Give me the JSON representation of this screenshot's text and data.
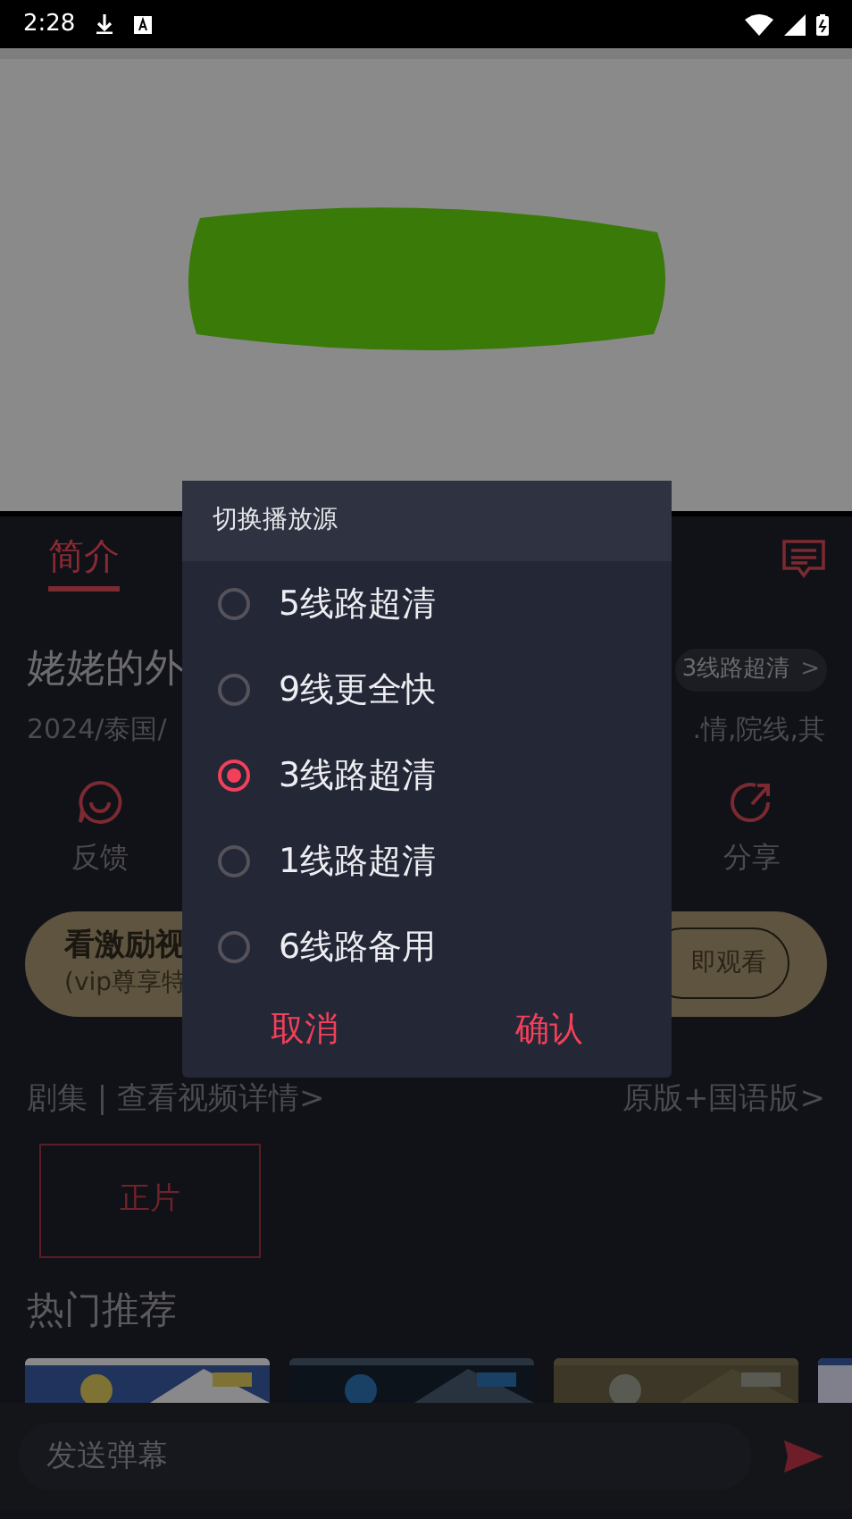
{
  "status_bar": {
    "time": "2:28"
  },
  "tabs": [
    {
      "label": "简介",
      "selected": true
    }
  ],
  "title": {
    "text": "姥姥的外",
    "source_badge": "3线路超清",
    "badge_arrow": ">"
  },
  "meta": {
    "left": "2024/泰国/",
    "right": ".情,院线,其"
  },
  "actions": [
    {
      "kind": "feedback",
      "label": "反馈"
    },
    {
      "kind": "share",
      "label": "分享"
    }
  ],
  "promo": {
    "title": "看激励视",
    "subtitle": "(vip尊享特",
    "button": "即观看"
  },
  "episodes": {
    "label": "剧集 | 查看视频详情>",
    "version": "原版+国语版>",
    "items": [
      {
        "label": "正片",
        "selected": true
      }
    ]
  },
  "recommend": {
    "title": "热门推荐"
  },
  "danmaku": {
    "placeholder": "发送弹幕"
  },
  "dialog": {
    "title": "切换播放源",
    "options": [
      {
        "label": "5线路超清",
        "selected": false
      },
      {
        "label": "9线更全快",
        "selected": false
      },
      {
        "label": "3线路超清",
        "selected": true
      },
      {
        "label": "1线路超清",
        "selected": false
      },
      {
        "label": "6线路备用",
        "selected": false
      }
    ],
    "cancel": "取消",
    "confirm": "确认"
  }
}
